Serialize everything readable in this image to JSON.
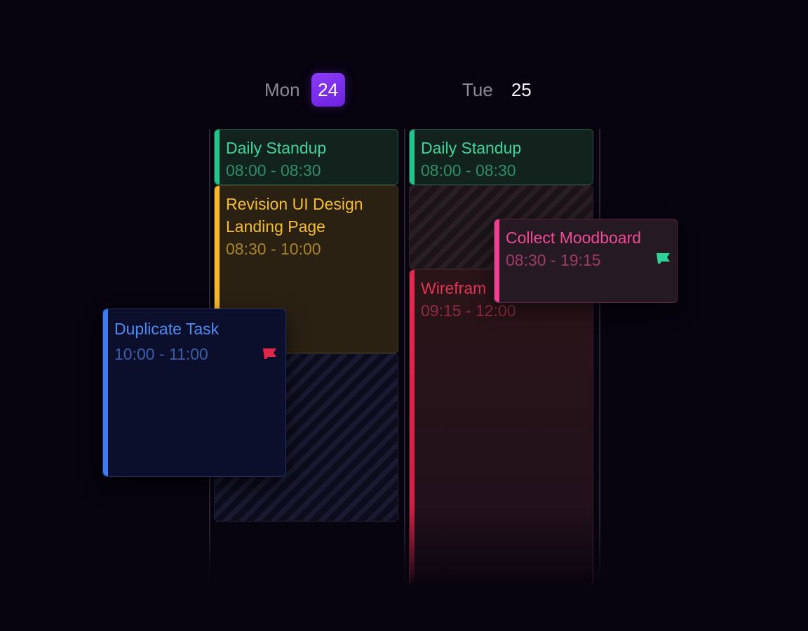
{
  "days": [
    {
      "name": "Mon",
      "number": "24",
      "today": true
    },
    {
      "name": "Tue",
      "number": "25",
      "today": false
    }
  ],
  "events": {
    "mon_standup": {
      "title": "Daily Standup",
      "time": "08:00 - 08:30"
    },
    "mon_revision": {
      "title_line1": "Revision UI Design",
      "title_line2": "Landing Page",
      "time": "08:30 - 10:00"
    },
    "duplicate": {
      "title": "Duplicate Task",
      "time": "10:00 - 11:00",
      "flag_icon": "flag-icon",
      "flag_color": "#e0274a"
    },
    "tue_standup": {
      "title": "Daily Standup",
      "time": "08:00 - 08:30"
    },
    "wireframe": {
      "title": "Wirefram",
      "time": "09:15 - 12:00"
    },
    "moodboard": {
      "title": "Collect Moodboard",
      "time": "08:30 - 19:15",
      "flag_icon": "flag-icon",
      "flag_color": "#2fd39a"
    }
  },
  "colors": {
    "background": "#07030f",
    "today_accent": "#7c3aed",
    "green": "#22c58c",
    "amber": "#f5b82a",
    "crimson": "#e5284e",
    "blue": "#3d7bf0",
    "pink": "#ef3f8f"
  }
}
